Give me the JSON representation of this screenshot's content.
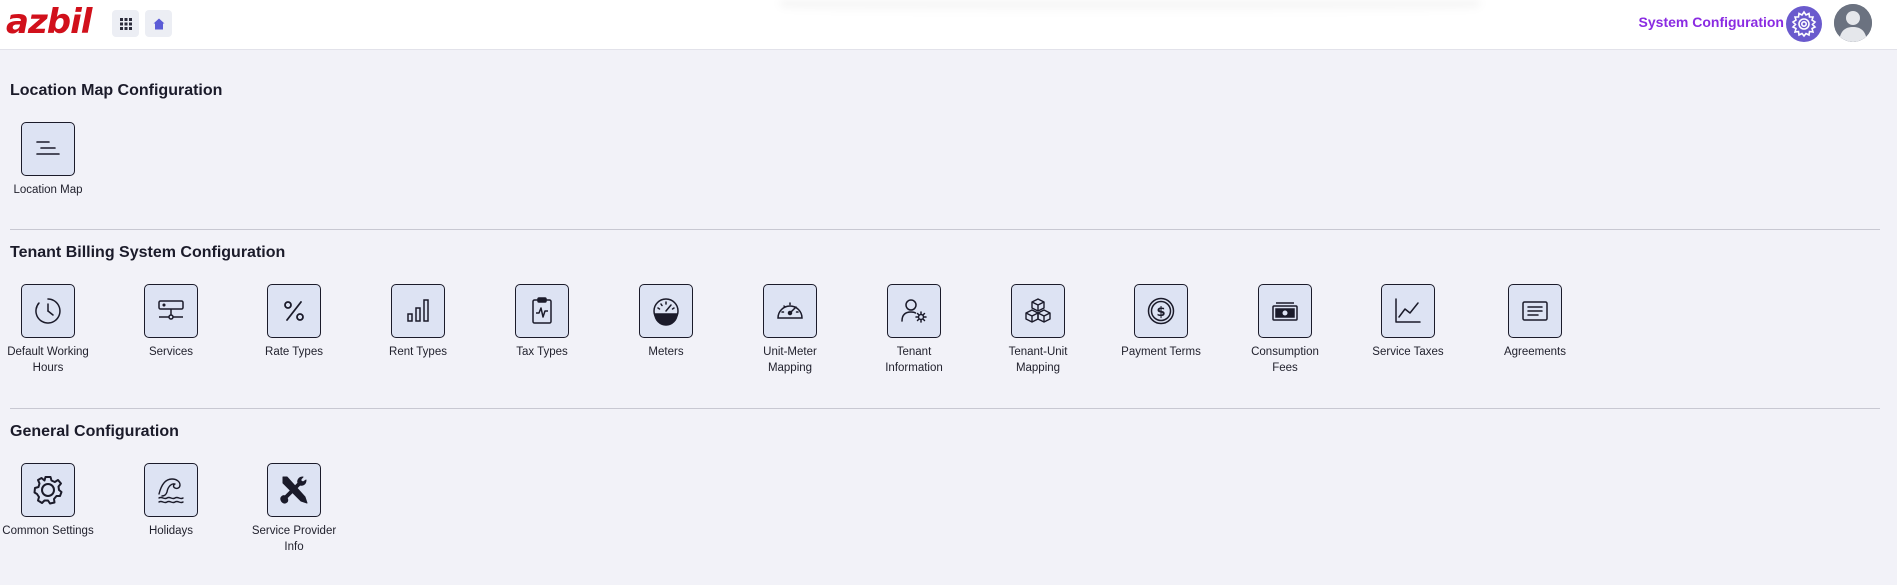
{
  "header": {
    "logo": "azbil",
    "title": "System Configuration",
    "apps_icon": "grid-icon",
    "home_icon": "home-icon",
    "settings_icon": "gear-icon",
    "avatar_icon": "user-avatar-icon",
    "accent_color": "#8a2be2",
    "brand_color": "#d1101b"
  },
  "sections": {
    "location": {
      "title": "Location Map Configuration",
      "items": [
        {
          "label": "Location Map",
          "icon": "lines-icon"
        }
      ]
    },
    "tenant": {
      "title": "Tenant Billing System Configuration",
      "items": [
        {
          "label": "Default Working Hours",
          "icon": "clock-icon"
        },
        {
          "label": "Services",
          "icon": "network-icon"
        },
        {
          "label": "Rate Types",
          "icon": "percent-icon"
        },
        {
          "label": "Rent Types",
          "icon": "bar-chart-icon"
        },
        {
          "label": "Tax Types",
          "icon": "clipboard-pulse-icon"
        },
        {
          "label": "Meters",
          "icon": "gauge-icon"
        },
        {
          "label": "Unit-Meter Mapping",
          "icon": "speedometer-icon"
        },
        {
          "label": "Tenant Information",
          "icon": "user-gear-icon"
        },
        {
          "label": "Tenant-Unit Mapping",
          "icon": "boxes-icon"
        },
        {
          "label": "Payment Terms",
          "icon": "dollar-coin-icon"
        },
        {
          "label": "Consumption Fees",
          "icon": "cash-icon"
        },
        {
          "label": "Service Taxes",
          "icon": "line-chart-icon"
        },
        {
          "label": "Agreements",
          "icon": "document-icon"
        }
      ]
    },
    "general": {
      "title": "General Configuration",
      "items": [
        {
          "label": "Common Settings",
          "icon": "gear-icon"
        },
        {
          "label": "Holidays",
          "icon": "wave-icon"
        },
        {
          "label": "Service Provider Info",
          "icon": "tools-icon"
        }
      ]
    }
  }
}
